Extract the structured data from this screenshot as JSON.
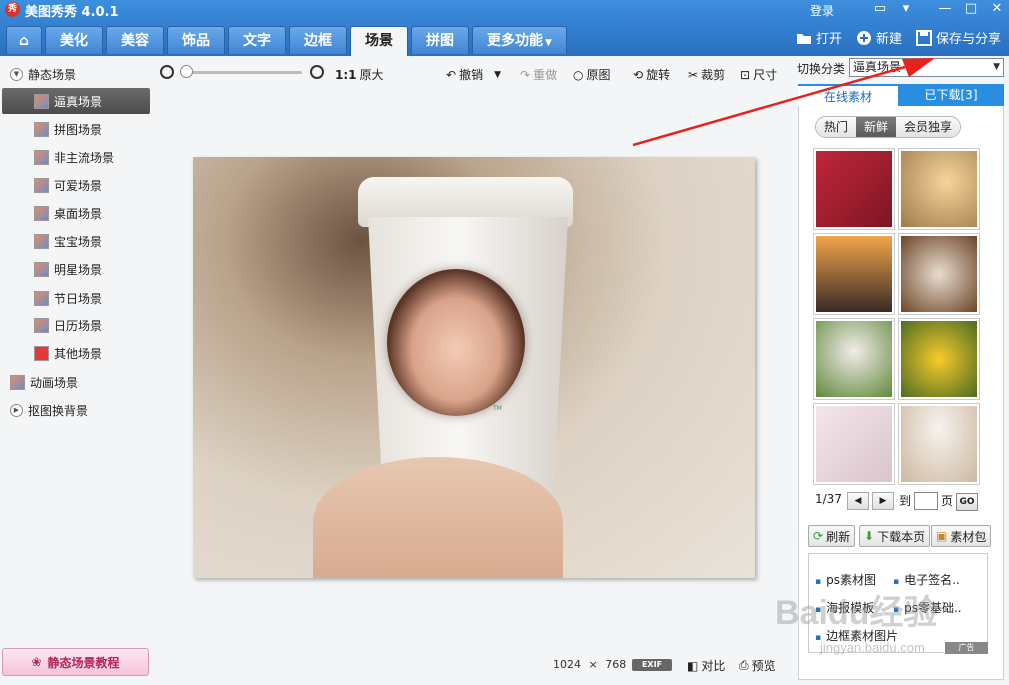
{
  "app": {
    "title": "美图秀秀 4.0.1",
    "logo_text": "秀",
    "login": "登录"
  },
  "tabs": [
    {
      "label": ""
    },
    {
      "label": "美化"
    },
    {
      "label": "美容"
    },
    {
      "label": "饰品"
    },
    {
      "label": "文字"
    },
    {
      "label": "边框"
    },
    {
      "label": "场景"
    },
    {
      "label": "拼图"
    },
    {
      "label": "更多功能"
    }
  ],
  "top_actions": {
    "open": "打开",
    "new": "新建",
    "save_share": "保存与分享"
  },
  "sidebar": {
    "static_section": "静态场景",
    "items": [
      {
        "label": "逼真场景"
      },
      {
        "label": "拼图场景"
      },
      {
        "label": "非主流场景"
      },
      {
        "label": "可爱场景"
      },
      {
        "label": "桌面场景"
      },
      {
        "label": "宝宝场景"
      },
      {
        "label": "明星场景"
      },
      {
        "label": "节日场景"
      },
      {
        "label": "日历场景"
      },
      {
        "label": "其他场景"
      }
    ],
    "anim_section": "动画场景",
    "cutout_section": "抠图换背景",
    "tutorial": "静态场景教程"
  },
  "toolbar": {
    "ratio": "1:1",
    "original_size": "原大",
    "undo": "撤销",
    "redo": "重做",
    "original": "原图",
    "rotate": "旋转",
    "crop": "裁剪",
    "resize": "尺寸",
    "zoom_level": 0
  },
  "canvas": {
    "cup_tm": "TM"
  },
  "status": {
    "width": "1024",
    "times": "×",
    "height": "768",
    "exif": "EXIF",
    "compare": "对比",
    "preview": "预览"
  },
  "right_panel": {
    "category_label": "切换分类",
    "category_value": "逼真场景",
    "tab_online": "在线素材",
    "tab_downloaded": "已下载[3]",
    "filters": [
      "热门",
      "新鲜",
      "会员独享"
    ],
    "pager": {
      "current": "1/37",
      "to": "到",
      "page": "页",
      "go": "GO"
    },
    "buttons": {
      "refresh": "刷新",
      "download_page": "下载本页",
      "package": "素材包"
    },
    "ads": [
      "ps素材图",
      "电子签名..",
      "海报模板",
      "ps零基础..",
      "边框素材图片"
    ],
    "ad_tag": "广告"
  },
  "watermark": {
    "main": "Baidu经验",
    "sub": "jingyan.baidu.com"
  },
  "colors": {
    "title_blue": "#2a6fc0",
    "arrow_red": "#e8221b",
    "selected_dark": "#4c4c4c"
  }
}
